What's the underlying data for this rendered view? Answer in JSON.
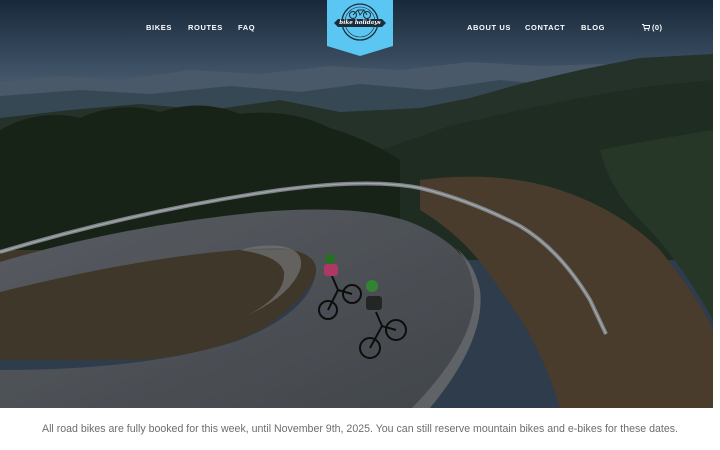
{
  "nav": {
    "left": [
      {
        "label": "BIKES"
      },
      {
        "label": "ROUTES"
      },
      {
        "label": "FAQ"
      }
    ],
    "right": [
      {
        "label": "ABOUT US"
      },
      {
        "label": "CONTACT"
      },
      {
        "label": "BLOG"
      }
    ],
    "cart": {
      "icon": "cart-icon",
      "label": "(0)"
    }
  },
  "logo": {
    "icon": "bicycle-icon",
    "text": "bike holidays",
    "color": "#5bc6f2"
  },
  "notice": {
    "text": "All road bikes are fully booked for this week, until November 9th, 2025. You can still reserve mountain bikes and e-bikes for these dates."
  },
  "colors": {
    "accent": "#5bc6f2",
    "nav_text": "#ffffff",
    "notice_text": "#6d6d6d"
  }
}
